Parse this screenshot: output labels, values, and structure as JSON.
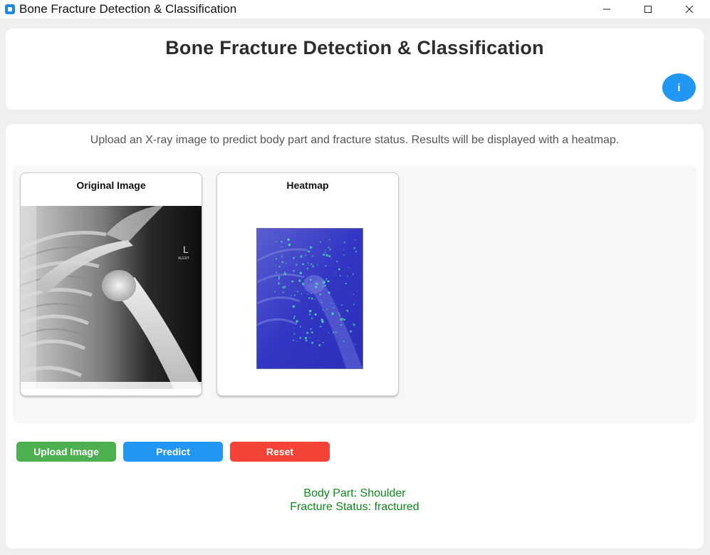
{
  "window": {
    "title": "Bone Fracture Detection & Classification",
    "controls": {
      "minimize_icon": "minimize-icon",
      "maximize_icon": "maximize-icon",
      "close_icon": "close-icon"
    }
  },
  "header": {
    "title": "Bone Fracture Detection & Classification",
    "info_label": "i"
  },
  "main": {
    "instructions": "Upload an X-ray image to predict body part and fracture status. Results will be displayed with a heatmap.",
    "original_card": {
      "label": "Original Image"
    },
    "heatmap_card": {
      "label": "Heatmap"
    }
  },
  "buttons": {
    "upload_label": "Upload Image",
    "predict_label": "Predict",
    "reset_label": "Reset"
  },
  "results": {
    "body_part": "Body Part: Shoulder",
    "fracture_status": "Fracture Status: fractured"
  },
  "colors": {
    "upload": "#4caf50",
    "predict": "#2196f3",
    "reset": "#f44336",
    "info": "#2196f3",
    "result_text": "#0b8a1a"
  }
}
